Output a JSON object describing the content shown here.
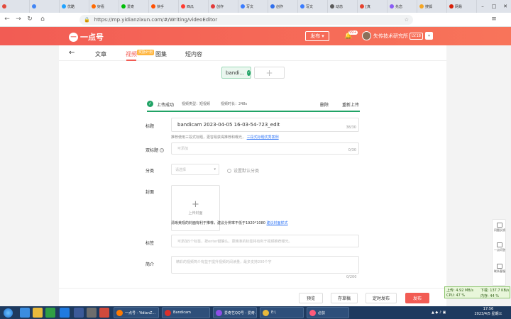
{
  "browser": {
    "tabs": [
      {
        "label": "",
        "color": "#e24a3b"
      },
      {
        "label": "",
        "color": "#4285f4"
      },
      {
        "label": "优酷",
        "color": "#1fa2ff"
      },
      {
        "label": "好看",
        "color": "#ff6a00"
      },
      {
        "label": "爱奇",
        "color": "#00be06"
      },
      {
        "label": "快手",
        "color": "#ff5000"
      },
      {
        "label": "西瓜",
        "color": "#ff3b30"
      },
      {
        "label": "创作",
        "color": "#e23a3a"
      },
      {
        "label": "写文",
        "color": "#3b7cff"
      },
      {
        "label": "创作",
        "color": "#2f6fed"
      },
      {
        "label": "写文",
        "color": "#3b7cff"
      },
      {
        "label": "动态",
        "color": "#5a5a5a"
      },
      {
        "label": "[真",
        "color": "#e5412d"
      },
      {
        "label": "先恋",
        "color": "#8a5cf5"
      },
      {
        "label": "搜狐",
        "color": "#f5a623"
      },
      {
        "label": "网易",
        "color": "#d81e06"
      },
      {
        "label": "一点",
        "color": "#f25c54",
        "active": true
      },
      {
        "label": "短剧",
        "color": "#4a90e2"
      }
    ],
    "url": "https://mp.yidianzixun.com/#/Writing/videoEditor"
  },
  "header": {
    "logo_text": "一点号",
    "publish_label": "发布",
    "notice_count": "99+",
    "username": "失传技术研究所",
    "level": "LV.18"
  },
  "nav": {
    "back_icon": "arrow-left-icon",
    "tabs": [
      "文章",
      "视频",
      "图集",
      "短内容"
    ],
    "active_tab": "视频",
    "badge": "奖励计划"
  },
  "video": {
    "chip_label": "bandi..."
  },
  "upload": {
    "status": "上传成功",
    "type": "视频类型：短视频",
    "duration": "视频时长：248s",
    "delete": "删除",
    "reupload": "重新上传"
  },
  "form": {
    "title_label": "标题",
    "title_value": "bandicam 2023-04-05 16-03-54-723_edit",
    "title_count": "38/30",
    "title_hint": "推荐使用三段式标题，更容易获得推荐和曝光，",
    "title_hint_link": "三段式标题优秀案例",
    "subtitle_label": "双标题",
    "subtitle_placeholder": "可添加",
    "subtitle_count": "0/30",
    "category_label": "分类",
    "category_placeholder": "请选择",
    "default_category": "设置默认分类",
    "cover_label": "封面",
    "cover_upload": "上传封面",
    "cover_hint": "清晰美观的封面有利于推荐，建议分辨率不低于1920*1080",
    "cover_hint_link": "建议封面样式",
    "tags_label": "标签",
    "tags_placeholder": "可添加5个标签，按enter键确认，更精准的标签将有利于视频推荐曝光。",
    "intro_label": "简介",
    "intro_placeholder": "精彩的视频简介有益于提升视频的阅读量，最多支持200个字",
    "intro_count": "0/200"
  },
  "actions": {
    "preview": "预览",
    "save_draft": "存草稿",
    "schedule": "定时发布",
    "publish": "发布"
  },
  "side_float": {
    "feedback": "问题反馈",
    "help": "一点问答",
    "contact": "联系客服"
  },
  "net_widget": {
    "upload": "上传: 4.92 MB/s",
    "download": "下载: 137.7 KB/s",
    "cpu": "CPU: 47 %",
    "mem": "内存: 44 %"
  },
  "taskbar": {
    "apps": [
      {
        "label": "一点号 - YidianZ...",
        "color": "#ff7a00"
      },
      {
        "label": "Bandicam",
        "color": "#d9302b"
      },
      {
        "label": "爱奇艺QQ号 - 爱奇...",
        "color": "#8f4fe8"
      },
      {
        "label": "E:\\",
        "color": "#e8b93c"
      },
      {
        "label": "必剪",
        "color": "#ff5a7a"
      }
    ],
    "time": "17:56",
    "date": "2023/4/5 星期三"
  }
}
